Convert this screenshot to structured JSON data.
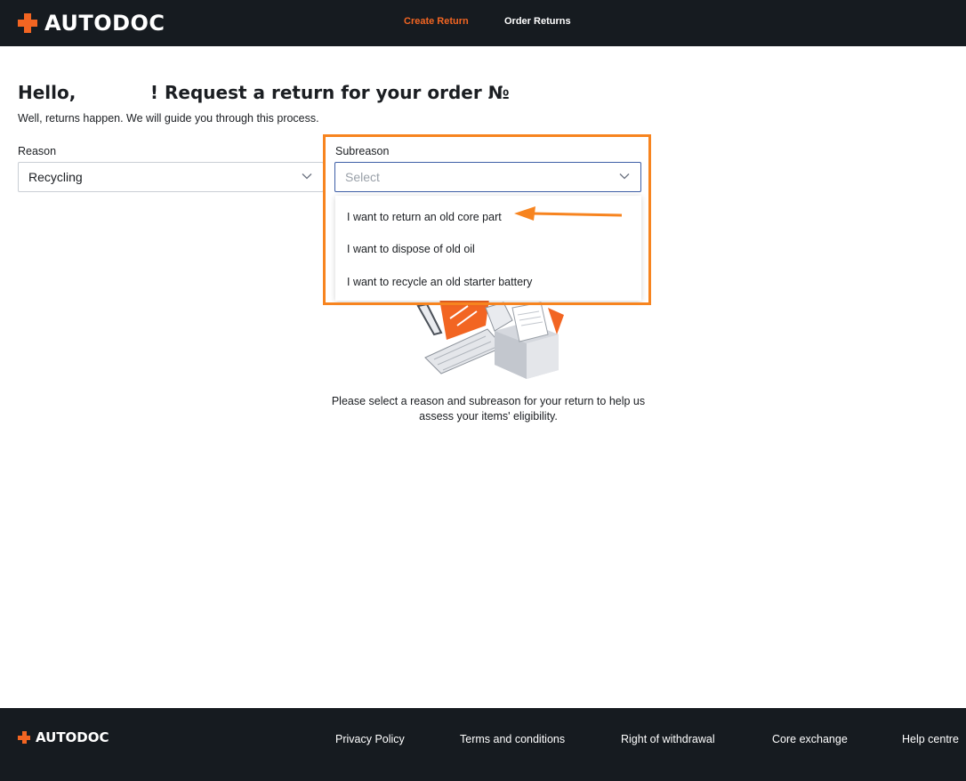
{
  "header": {
    "brand": "AUTODOC",
    "nav": [
      {
        "label": "Create Return"
      },
      {
        "label": "Order Returns"
      }
    ]
  },
  "main": {
    "title": "Hello,            ! Request a return for your order №",
    "subtitle": "Well, returns happen. We will guide you through this process.",
    "reason": {
      "label": "Reason",
      "value": "Recycling"
    },
    "subreason": {
      "label": "Subreason",
      "placeholder": "Select",
      "options": [
        "I want to return an old core part",
        "I want to dispose of old oil",
        "I want to recycle an old starter battery"
      ]
    },
    "help_text": "Please select a reason and subreason for your return to help us assess your items' eligibility."
  },
  "footer": {
    "brand": "AUTODOC",
    "links": [
      "Privacy Policy",
      "Terms and conditions",
      "Right of withdrawal",
      "Core exchange",
      "Help centre"
    ]
  },
  "colors": {
    "accent": "#f26522",
    "annotation": "#f7841f",
    "dark": "#161b20"
  }
}
